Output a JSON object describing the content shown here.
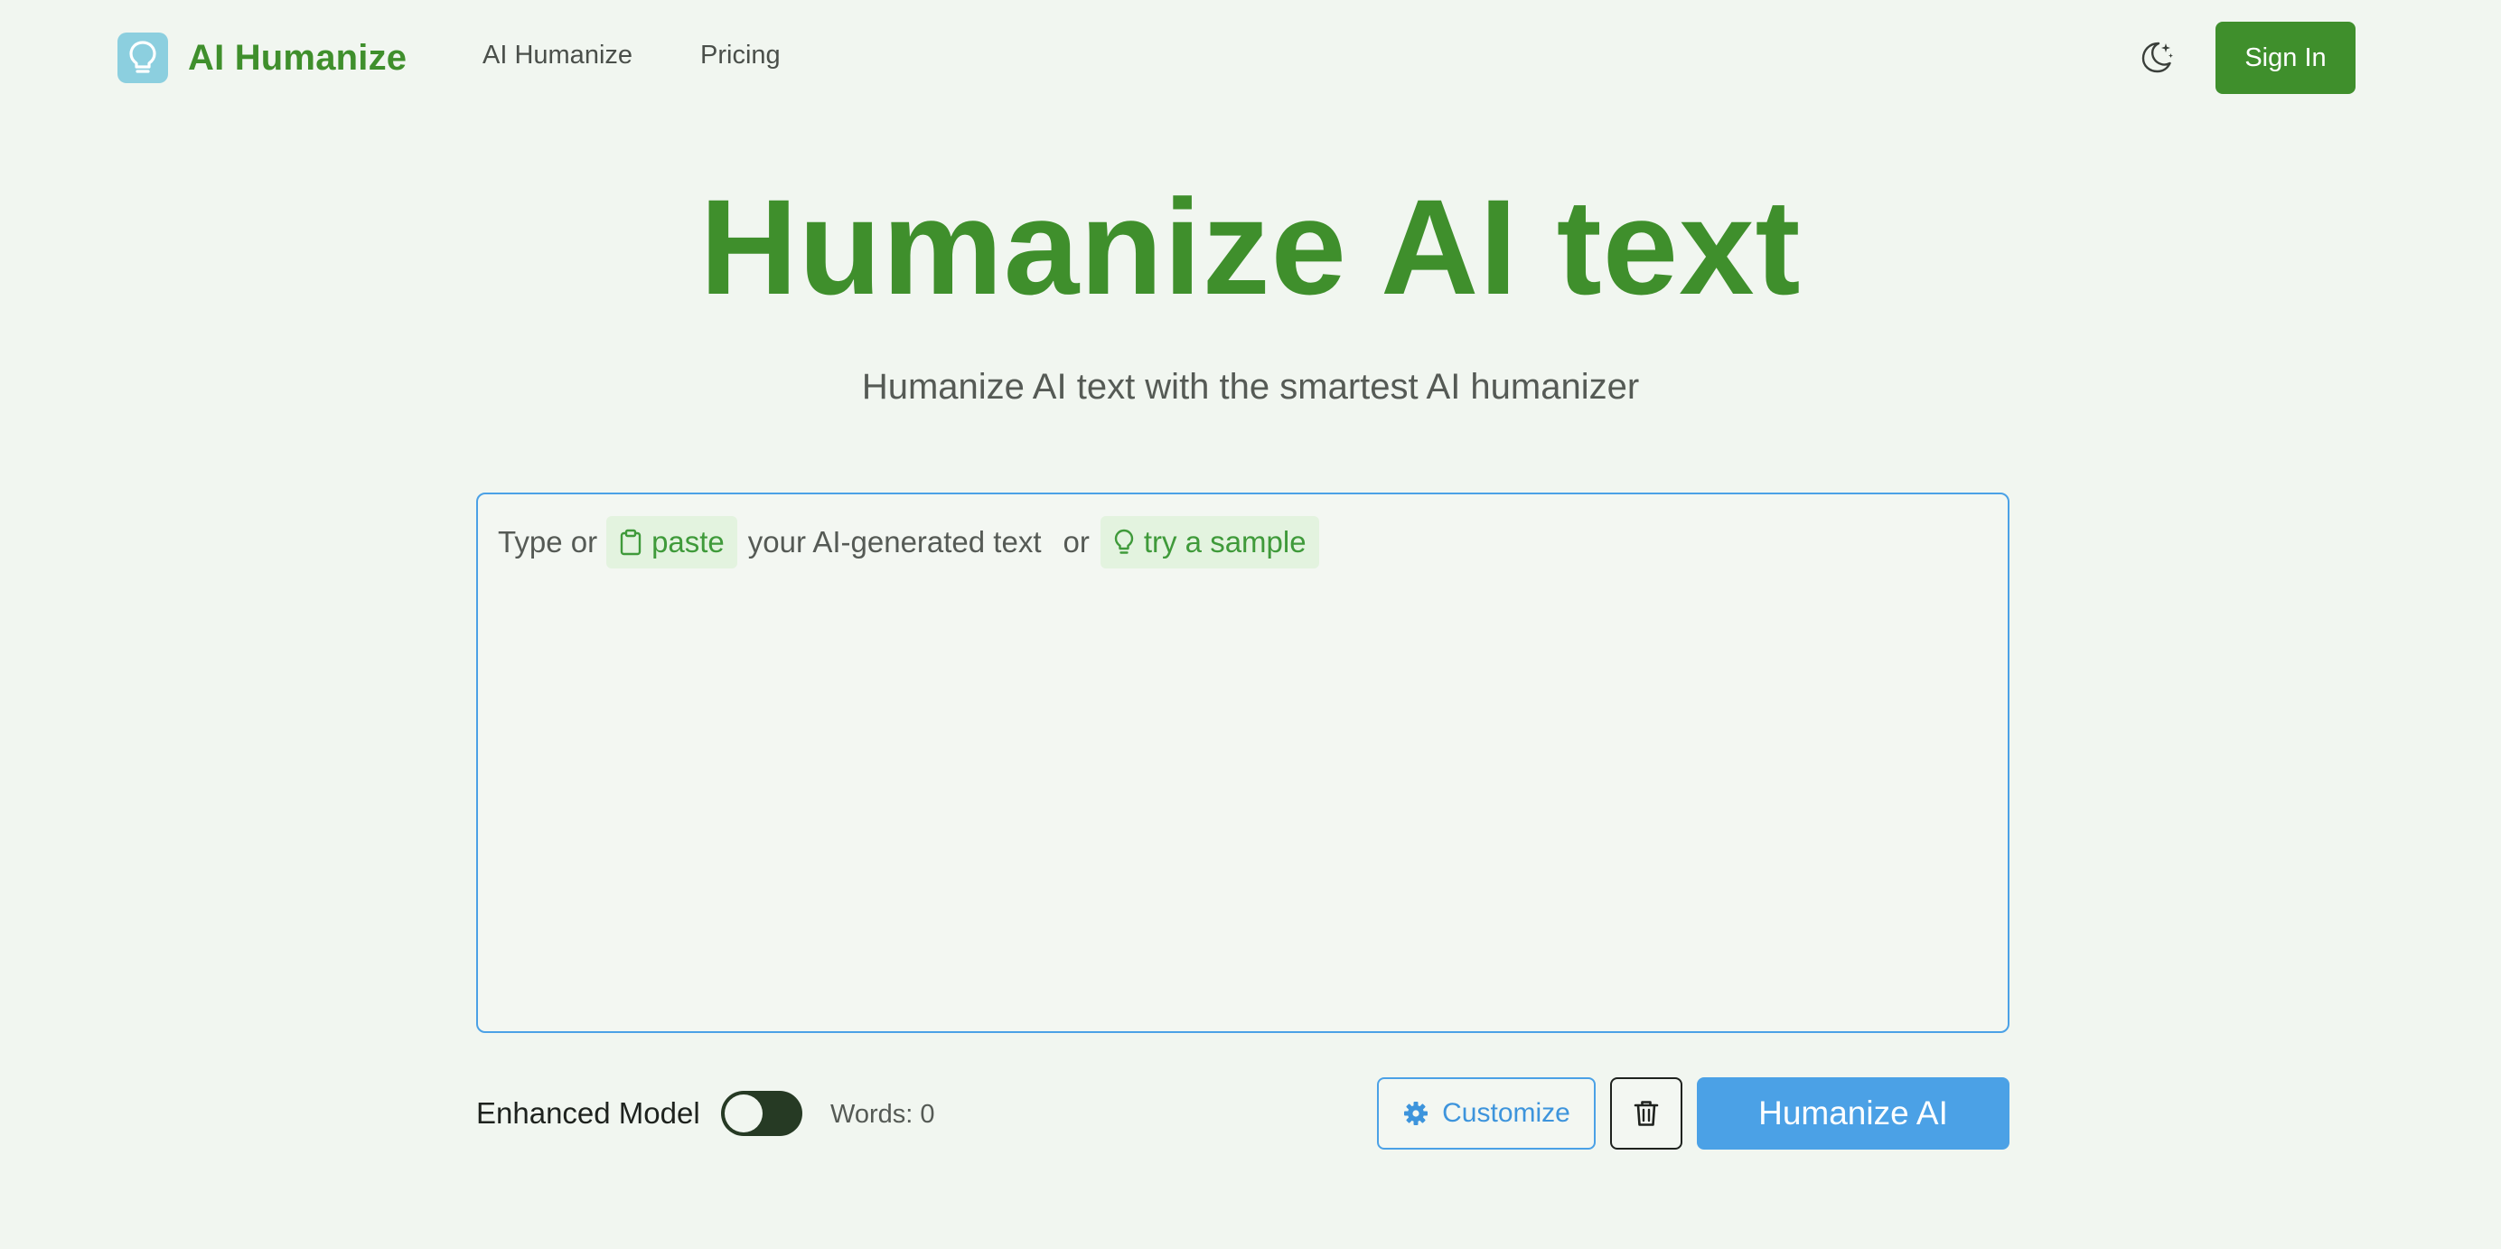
{
  "header": {
    "brand": "AI Humanize",
    "nav": [
      {
        "label": "AI Humanize"
      },
      {
        "label": "Pricing"
      }
    ],
    "theme_icon": "moon-stars-icon",
    "sign_in_label": "Sign In"
  },
  "hero": {
    "title": "Humanize AI text",
    "subtitle": "Humanize AI text with the smartest AI humanizer"
  },
  "editor": {
    "prompt_start": "Type or",
    "paste_label": "paste",
    "prompt_middle": "your AI-generated text",
    "prompt_or": "or",
    "sample_label": "try a sample"
  },
  "controls": {
    "enhanced_model_label": "Enhanced Model",
    "enhanced_model_on": false,
    "words_label": "Words:",
    "words_count": "0",
    "customize_label": "Customize",
    "humanize_label": "Humanize AI"
  },
  "colors": {
    "brand_green": "#3f8f2c",
    "accent_blue": "#4ba1e6",
    "background": "#f1f6f0",
    "logo_badge": "#8ccfdf"
  }
}
